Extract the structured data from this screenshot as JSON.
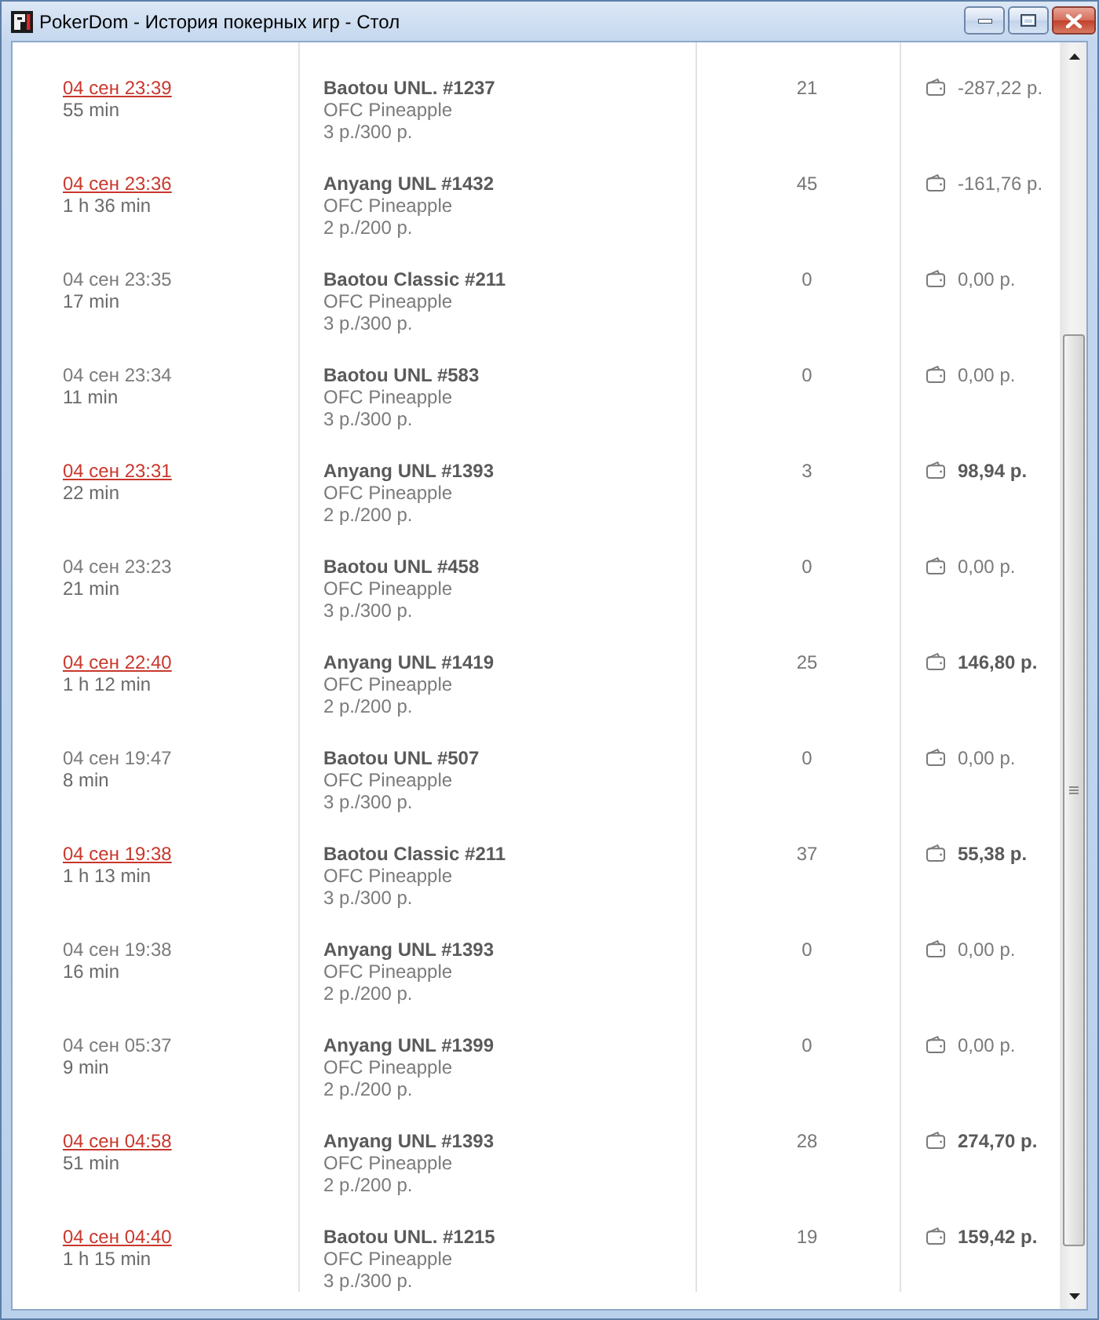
{
  "window": {
    "title": "PokerDom - История покерных игр - Стол"
  },
  "games": [
    {
      "kind": "loss",
      "date": "04 сен 23:39",
      "duration": "55 min",
      "table": "Baotou UNL. #1237",
      "game": "OFC Pineapple",
      "stakes": "3 р./300 р.",
      "hands": "21",
      "result": "-287,22 р."
    },
    {
      "kind": "loss",
      "date": "04 сен 23:36",
      "duration": "1 h 36 min",
      "table": "Anyang UNL #1432",
      "game": "OFC Pineapple",
      "stakes": "2 р./200 р.",
      "hands": "45",
      "result": "-161,76 р."
    },
    {
      "kind": "empty",
      "date": "04 сен 23:35",
      "duration": "17 min",
      "table": "Baotou Classic #211",
      "game": "OFC Pineapple",
      "stakes": "3 р./300 р.",
      "hands": "0",
      "result": "0,00 р."
    },
    {
      "kind": "empty",
      "date": "04 сен 23:34",
      "duration": "11 min",
      "table": "Baotou UNL #583",
      "game": "OFC Pineapple",
      "stakes": "3 р./300 р.",
      "hands": "0",
      "result": "0,00 р."
    },
    {
      "kind": "win",
      "date": "04 сен 23:31",
      "duration": "22 min",
      "table": "Anyang UNL #1393",
      "game": "OFC Pineapple",
      "stakes": "2 р./200 р.",
      "hands": "3",
      "result": "98,94 р."
    },
    {
      "kind": "empty",
      "date": "04 сен 23:23",
      "duration": "21 min",
      "table": "Baotou UNL #458",
      "game": "OFC Pineapple",
      "stakes": "3 р./300 р.",
      "hands": "0",
      "result": "0,00 р."
    },
    {
      "kind": "win",
      "date": "04 сен 22:40",
      "duration": "1 h 12 min",
      "table": "Anyang UNL #1419",
      "game": "OFC Pineapple",
      "stakes": "2 р./200 р.",
      "hands": "25",
      "result": "146,80 р."
    },
    {
      "kind": "empty",
      "date": "04 сен 19:47",
      "duration": "8 min",
      "table": "Baotou UNL #507",
      "game": "OFC Pineapple",
      "stakes": "3 р./300 р.",
      "hands": "0",
      "result": "0,00 р."
    },
    {
      "kind": "win",
      "date": "04 сен 19:38",
      "duration": "1 h 13 min",
      "table": "Baotou Classic #211",
      "game": "OFC Pineapple",
      "stakes": "3 р./300 р.",
      "hands": "37",
      "result": "55,38 р."
    },
    {
      "kind": "empty",
      "date": "04 сен 19:38",
      "duration": "16 min",
      "table": "Anyang UNL #1393",
      "game": "OFC Pineapple",
      "stakes": "2 р./200 р.",
      "hands": "0",
      "result": "0,00 р."
    },
    {
      "kind": "empty",
      "date": "04 сен 05:37",
      "duration": "9 min",
      "table": "Anyang UNL #1399",
      "game": "OFC Pineapple",
      "stakes": "2 р./200 р.",
      "hands": "0",
      "result": "0,00 р."
    },
    {
      "kind": "win",
      "date": "04 сен 04:58",
      "duration": "51 min",
      "table": "Anyang UNL #1393",
      "game": "OFC Pineapple",
      "stakes": "2 р./200 р.",
      "hands": "28",
      "result": "274,70 р."
    },
    {
      "kind": "win",
      "date": "04 сен 04:40",
      "duration": "1 h 15 min",
      "table": "Baotou UNL. #1215",
      "game": "OFC Pineapple",
      "stakes": "3 р./300 р.",
      "hands": "19",
      "result": "159,42 р."
    }
  ]
}
